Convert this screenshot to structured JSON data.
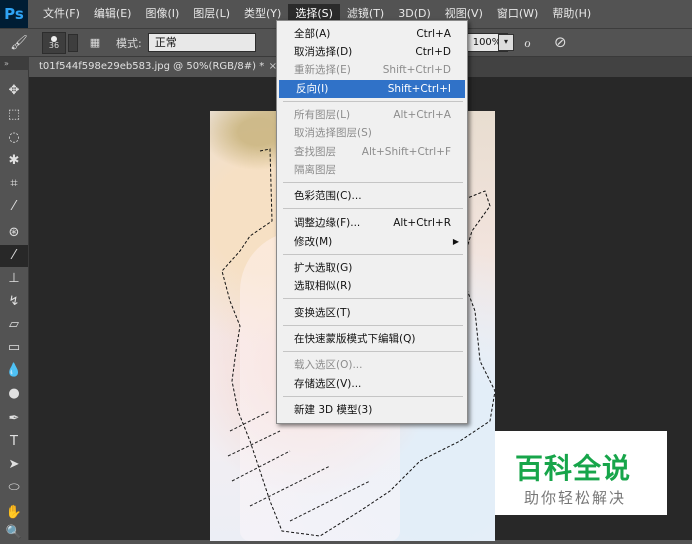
{
  "menubar": {
    "logo": "Ps",
    "items": [
      {
        "label": "文件(F)",
        "active": false
      },
      {
        "label": "编辑(E)",
        "active": false
      },
      {
        "label": "图像(I)",
        "active": false
      },
      {
        "label": "图层(L)",
        "active": false
      },
      {
        "label": "类型(Y)",
        "active": false
      },
      {
        "label": "选择(S)",
        "active": true
      },
      {
        "label": "滤镜(T)",
        "active": false
      },
      {
        "label": "3D(D)",
        "active": false
      },
      {
        "label": "视图(V)",
        "active": false
      },
      {
        "label": "窗口(W)",
        "active": false
      },
      {
        "label": "帮助(H)",
        "active": false
      }
    ]
  },
  "options": {
    "brush_size": "36",
    "mode_label": "模式:",
    "mode_value": "正常",
    "zoom": "100%"
  },
  "document": {
    "tab_title": "t01f544f598e29eb583.jpg @ 50%(RGB/8#) *",
    "close": "×"
  },
  "select_menu": {
    "items": [
      {
        "label": "全部(A)",
        "shortcut": "Ctrl+A",
        "disabled": false,
        "highlighted": false
      },
      {
        "label": "取消选择(D)",
        "shortcut": "Ctrl+D",
        "disabled": false,
        "highlighted": false
      },
      {
        "label": "重新选择(E)",
        "shortcut": "Shift+Ctrl+D",
        "disabled": true,
        "highlighted": false
      },
      {
        "label": "反向(I)",
        "shortcut": "Shift+Ctrl+I",
        "disabled": false,
        "highlighted": true
      },
      {
        "label": "所有图层(L)",
        "shortcut": "Alt+Ctrl+A",
        "disabled": true,
        "highlighted": false
      },
      {
        "label": "取消选择图层(S)",
        "shortcut": "",
        "disabled": true,
        "highlighted": false
      },
      {
        "label": "查找图层",
        "shortcut": "Alt+Shift+Ctrl+F",
        "disabled": true,
        "highlighted": false
      },
      {
        "label": "隔离图层",
        "shortcut": "",
        "disabled": true,
        "highlighted": false
      },
      {
        "label": "色彩范围(C)...",
        "shortcut": "",
        "disabled": false,
        "highlighted": false
      },
      {
        "label": "调整边缘(F)...",
        "shortcut": "Alt+Ctrl+R",
        "disabled": false,
        "highlighted": false
      },
      {
        "label": "修改(M)",
        "shortcut": "",
        "disabled": false,
        "highlighted": false,
        "submenu": true
      },
      {
        "label": "扩大选取(G)",
        "shortcut": "",
        "disabled": false,
        "highlighted": false
      },
      {
        "label": "选取相似(R)",
        "shortcut": "",
        "disabled": false,
        "highlighted": false
      },
      {
        "label": "变换选区(T)",
        "shortcut": "",
        "disabled": false,
        "highlighted": false
      },
      {
        "label": "在快速蒙版模式下编辑(Q)",
        "shortcut": "",
        "disabled": false,
        "highlighted": false
      },
      {
        "label": "载入选区(O)...",
        "shortcut": "",
        "disabled": true,
        "highlighted": false
      },
      {
        "label": "存储选区(V)...",
        "shortcut": "",
        "disabled": false,
        "highlighted": false
      },
      {
        "label": "新建 3D 模型(3)",
        "shortcut": "",
        "disabled": false,
        "highlighted": false
      }
    ]
  },
  "watermark": {
    "title": "百科全说",
    "subtitle": "助你轻松解决"
  },
  "colors": {
    "highlight": "#3072c8",
    "watermark_green": "#17a54a"
  }
}
